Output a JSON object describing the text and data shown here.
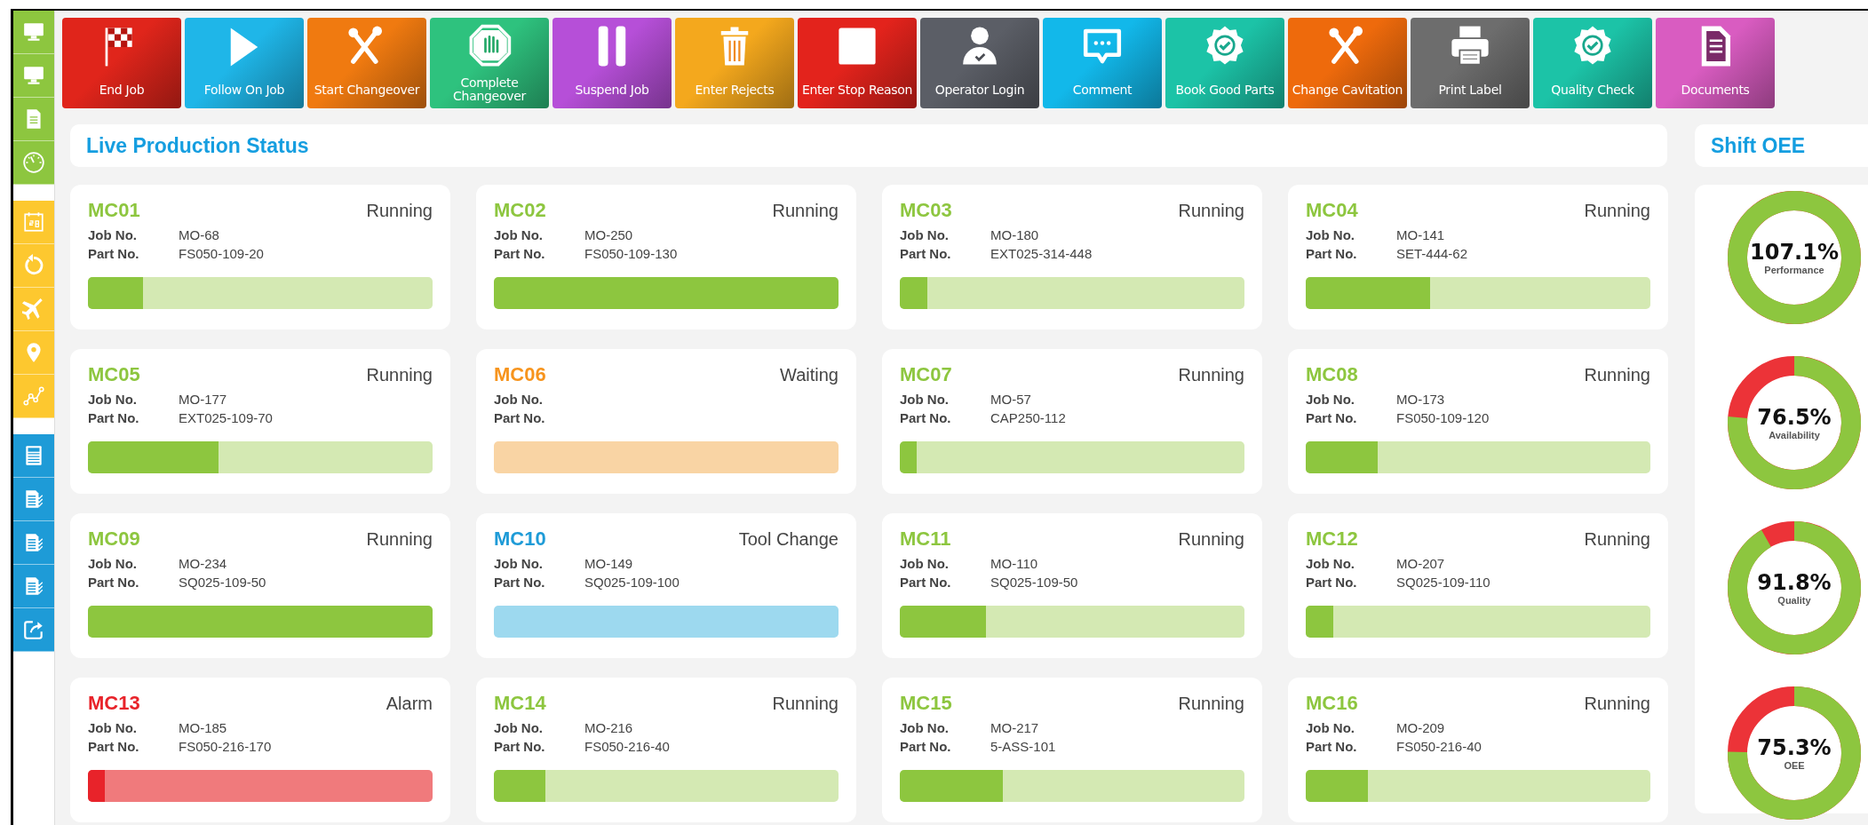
{
  "sidebar": {
    "items": [
      {
        "color": "#8dc63f"
      },
      {
        "color": "#8dc63f"
      },
      {
        "color": "#8dc63f"
      },
      {
        "color": "#8dc63f"
      },
      {
        "color": "#fdc82f"
      },
      {
        "color": "#fdc82f"
      },
      {
        "color": "#fdc82f"
      },
      {
        "color": "#fdc82f"
      },
      {
        "color": "#fdc82f"
      },
      {
        "color": "#1e9bd7"
      },
      {
        "color": "#1e9bd7"
      },
      {
        "color": "#1e9bd7"
      },
      {
        "color": "#1e9bd7"
      },
      {
        "color": "#1e9bd7"
      }
    ]
  },
  "toolbar": [
    {
      "label": "End Job",
      "color": "#e0251b"
    },
    {
      "label": "Follow On Job",
      "color": "#1fb6e8"
    },
    {
      "label": "Start Changeover",
      "color": "#f07a10"
    },
    {
      "label": "Complete Changeover",
      "color": "#2ec27e"
    },
    {
      "label": "Suspend Job",
      "color": "#b64fd8"
    },
    {
      "label": "Enter Rejects",
      "color": "#f4a81d"
    },
    {
      "label": "Enter Stop Reason",
      "color": "#e3231c"
    },
    {
      "label": "Operator Login",
      "color": "#5b5e66"
    },
    {
      "label": "Comment",
      "color": "#12b8ea"
    },
    {
      "label": "Book Good Parts",
      "color": "#1cc3a7"
    },
    {
      "label": "Change Cavitation",
      "color": "#ee6a0c"
    },
    {
      "label": "Print Label",
      "color": "#6d6d6d"
    },
    {
      "label": "Quality Check",
      "color": "#1cc3a7"
    },
    {
      "label": "Documents",
      "color": "#d95cc1"
    }
  ],
  "live_production": {
    "title": "Live Production Status",
    "machines": [
      {
        "name": "MC01",
        "status": "Running",
        "kind": "running",
        "job_label": "Job No.",
        "job": "MO-68",
        "part_label": "Part No.",
        "part": "FS050-109-20",
        "level": 0.16
      },
      {
        "name": "MC02",
        "status": "Running",
        "kind": "running",
        "job_label": "Job No.",
        "job": "MO-250",
        "part_label": "Part No.",
        "part": "FS050-109-130",
        "level": 1
      },
      {
        "name": "MC03",
        "status": "Running",
        "kind": "running",
        "job_label": "Job No.",
        "job": "MO-180",
        "part_label": "Part No.",
        "part": "EXT025-314-448",
        "level": 0.08
      },
      {
        "name": "MC04",
        "status": "Running",
        "kind": "running",
        "job_label": "Job No.",
        "job": "MO-141",
        "part_label": "Part No.",
        "part": "SET-444-62",
        "level": 0.36
      },
      {
        "name": "MC05",
        "status": "Running",
        "kind": "running",
        "job_label": "Job No.",
        "job": "MO-177",
        "part_label": "Part No.",
        "part": "EXT025-109-70",
        "level": 0.38
      },
      {
        "name": "MC06",
        "status": "Waiting",
        "kind": "waiting",
        "job_label": "Job No.",
        "part_label": "Part No.",
        "level": 0
      },
      {
        "name": "MC07",
        "status": "Running",
        "kind": "running",
        "job_label": "Job No.",
        "job": "MO-57",
        "part_label": "Part No.",
        "part": "CAP250-112",
        "level": 0.05
      },
      {
        "name": "MC08",
        "status": "Running",
        "kind": "running",
        "job_label": "Job No.",
        "job": "MO-173",
        "part_label": "Part No.",
        "part": "FS050-109-120",
        "level": 0.21
      },
      {
        "name": "MC09",
        "status": "Running",
        "kind": "running",
        "job_label": "Job No.",
        "job": "MO-234",
        "part_label": "Part No.",
        "part": "SQ025-109-50",
        "level": 1
      },
      {
        "name": "MC10",
        "status": "Tool Change",
        "kind": "tool_change",
        "job_label": "Job No.",
        "job": "MO-149",
        "part_label": "Part No.",
        "part": "SQ025-109-100",
        "level": 0
      },
      {
        "name": "MC11",
        "status": "Running",
        "kind": "running",
        "job_label": "Job No.",
        "job": "MO-110",
        "part_label": "Part No.",
        "part": "SQ025-109-50",
        "level": 0.25
      },
      {
        "name": "MC12",
        "status": "Running",
        "kind": "running",
        "job_label": "Job No.",
        "job": "MO-207",
        "part_label": "Part No.",
        "part": "SQ025-109-110",
        "level": 0.08
      },
      {
        "name": "MC13",
        "status": "Alarm",
        "kind": "alarm",
        "job_label": "Job No.",
        "job": "MO-185",
        "part_label": "Part No.",
        "part": "FS050-216-170",
        "level": 0.05
      },
      {
        "name": "MC14",
        "status": "Running",
        "kind": "running",
        "job_label": "Job No.",
        "job": "MO-216",
        "part_label": "Part No.",
        "part": "FS050-216-40",
        "level": 0.15
      },
      {
        "name": "MC15",
        "status": "Running",
        "kind": "running",
        "job_label": "Job No.",
        "job": "MO-217",
        "part_label": "Part No.",
        "part": "5-ASS-101",
        "level": 0.3
      },
      {
        "name": "MC16",
        "status": "Running",
        "kind": "running",
        "job_label": "Job No.",
        "job": "MO-209",
        "part_label": "Part No.",
        "part": "FS050-216-40",
        "level": 0.18
      }
    ]
  },
  "shift_oee": {
    "title": "Shift OEE",
    "gauges": [
      {
        "value": "107.1%",
        "label": "Performance"
      },
      {
        "value": "76.5%",
        "label": "Availability"
      },
      {
        "value": "91.8%",
        "label": "Quality"
      },
      {
        "value": "75.3%",
        "label": "OEE"
      }
    ]
  }
}
